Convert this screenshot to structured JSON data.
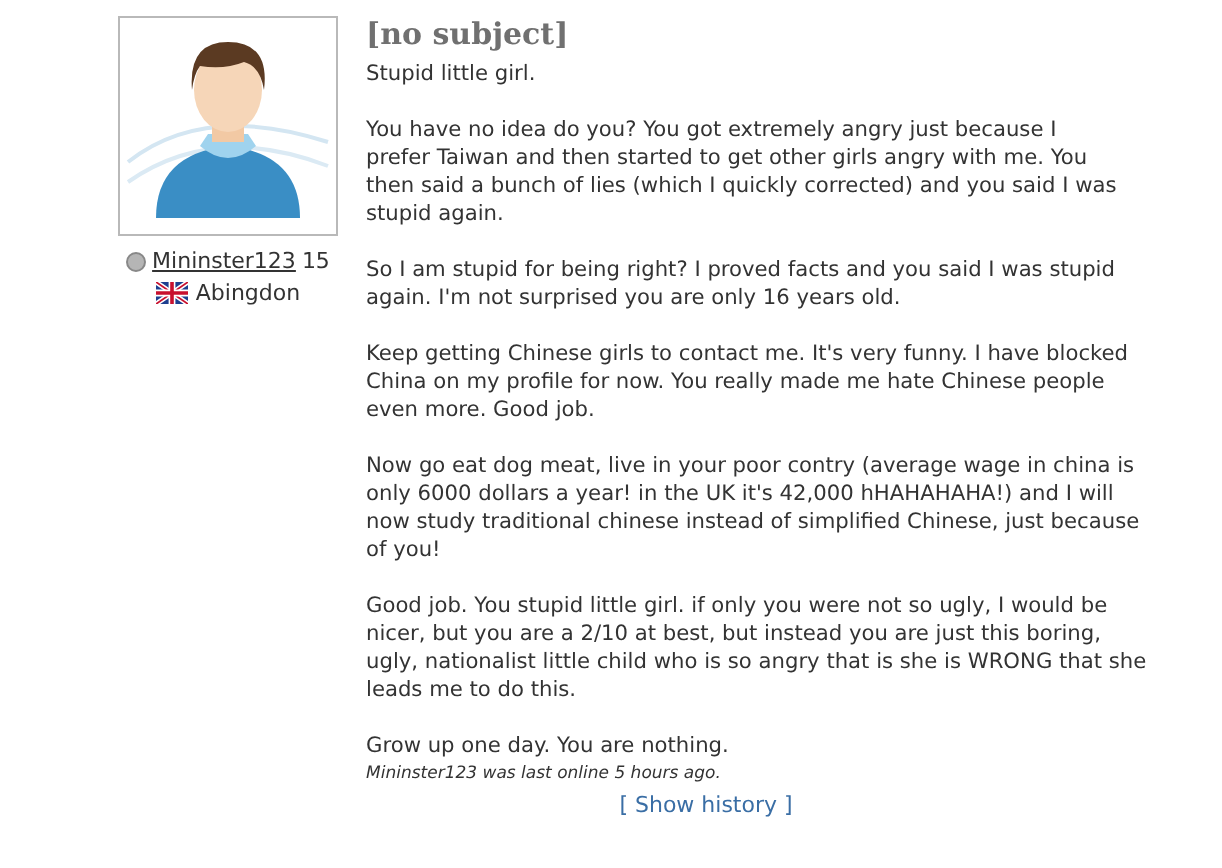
{
  "author": {
    "username": "Mininster123",
    "online": false,
    "age": "15",
    "location": "Abingdon"
  },
  "message": {
    "subject": "[no subject]",
    "paragraphs": [
      [
        "Stupid little girl."
      ],
      [
        "You have no idea do you? You got extremely angry just because I",
        "prefer Taiwan and then started to get other girls angry with me. You",
        "then said a bunch of lies (which I quickly corrected) and you said I was",
        "stupid again."
      ],
      [
        "So I am stupid for being right? I proved facts and you said I was stupid",
        "again. I'm not surprised you are only 16 years old."
      ],
      [
        "Keep getting Chinese girls to contact me. It's very funny. I have blocked",
        "China on my profile for now. You really made me hate Chinese people",
        "even more.  Good job."
      ],
      [
        "Now go eat dog meat, live in your poor contry (average wage in china is",
        "only 6000 dollars a year! in the UK it's 42,000 hHAHAHAHA!) and I will",
        "now study traditional chinese instead of simplified Chinese, just because",
        "of you!"
      ],
      [
        "Good job. You stupid little girl. if only you were not so ugly, I would be",
        "nicer, but you are a 2/10 at best, but instead you are just this boring,",
        "ugly, nationalist little child who is so angry that is she is WRONG that she",
        "leads me to do this."
      ],
      [
        "Grow up one day. You are nothing."
      ]
    ],
    "last_online": "Mininster123 was last online 5 hours ago.",
    "history_link": "[ Show history ]"
  }
}
